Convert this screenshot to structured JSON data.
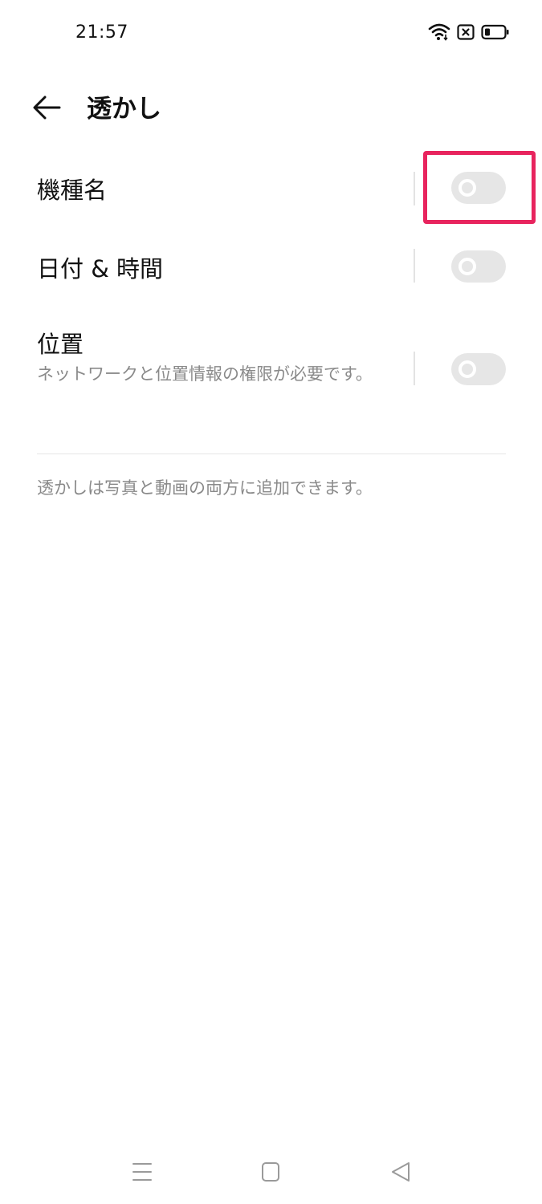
{
  "status_bar": {
    "time": "21:57",
    "icons": [
      "wifi-icon",
      "sim-error-icon",
      "battery-icon"
    ]
  },
  "header": {
    "back_icon": "back-arrow-icon",
    "title": "透かし"
  },
  "settings": [
    {
      "title": "機種名",
      "description": "",
      "enabled": false,
      "highlighted": true
    },
    {
      "title": "日付 & 時間",
      "description": "",
      "enabled": false,
      "highlighted": false
    },
    {
      "title": "位置",
      "description": "ネットワークと位置情報の権限が必要です。",
      "enabled": false,
      "highlighted": false
    }
  ],
  "footer_note": "透かしは写真と動画の両方に追加できます。",
  "nav_bar": {
    "icons": [
      "menu-icon",
      "home-icon",
      "back-triangle-icon"
    ]
  },
  "colors": {
    "highlight": "#e8245e",
    "toggle_off": "#e6e6e6",
    "secondary_text": "#8a8a8a"
  }
}
